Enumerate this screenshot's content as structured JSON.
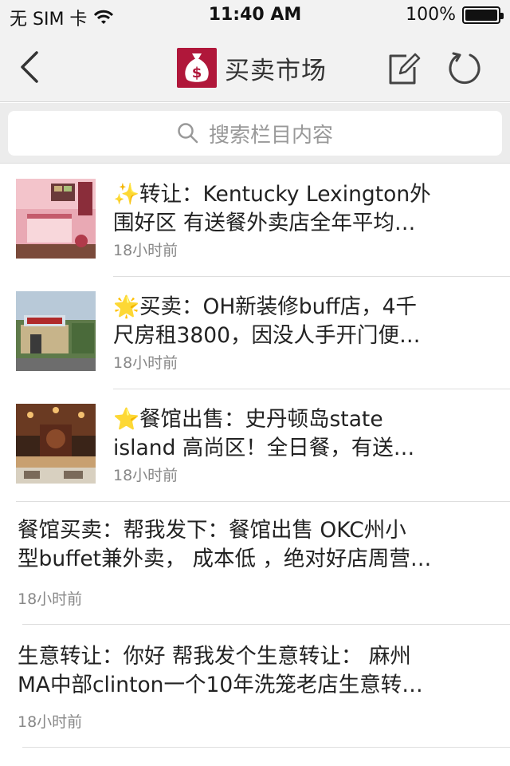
{
  "status_bar": {
    "carrier": "无 SIM 卡",
    "time": "11:40 AM",
    "battery": "100%",
    "battery_level": 1.0
  },
  "nav": {
    "title": "买卖市场",
    "logo_icon": "money-bag-icon",
    "brand_color": "#b0173a"
  },
  "search": {
    "placeholder": "搜索栏目内容"
  },
  "posts": [
    {
      "icon": "sparkles",
      "title_line1": "✨转让：Kentucky Lexington外",
      "title_line2": "围好区 有送餐外卖店全年平均…",
      "time": "18小时前"
    },
    {
      "icon": "glowing-star",
      "title_line1": "🌟买卖：OH新装修buff店，4千",
      "title_line2": "尺房租3800，因没人手开门便…",
      "time": "18小时前"
    },
    {
      "icon": "star",
      "title_line1": "⭐餐馆出售：史丹顿岛state",
      "title_line2": "island 高尚区！全日餐，有送…",
      "time": "18小时前"
    },
    {
      "title_line1": "餐馆买卖：帮我发下：餐馆出售 OKC州小",
      "title_line2": "型buffet兼外卖， 成本低 ，绝对好店周营…",
      "time": "18小时前"
    },
    {
      "title_line1": "生意转让：你好 帮我发个生意转让： 麻州",
      "title_line2": "MA中部clinton一个10年洗笼老店生意转…",
      "time": "18小时前"
    }
  ]
}
